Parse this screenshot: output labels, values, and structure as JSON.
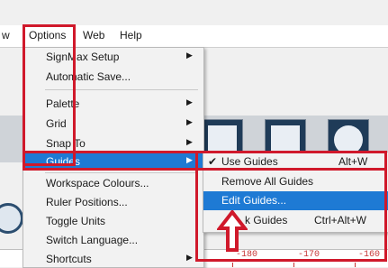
{
  "menubar": {
    "prev_menu_fragment": "w",
    "items": [
      "Options",
      "Web",
      "Help"
    ]
  },
  "options_menu": {
    "items": [
      {
        "label": "SignMax Setup",
        "submenu": true
      },
      {
        "label": "Automatic Save...",
        "submenu": false
      },
      {
        "label": "Palette",
        "submenu": true
      },
      {
        "label": "Grid",
        "submenu": true
      },
      {
        "label": "Snap To",
        "submenu": true
      },
      {
        "label": "Guides",
        "submenu": true,
        "highlighted": true
      },
      {
        "label": "Workspace Colours...",
        "submenu": false
      },
      {
        "label": "Ruler Positions...",
        "submenu": false
      },
      {
        "label": "Toggle Units",
        "submenu": false
      },
      {
        "label": "Switch Language...",
        "submenu": false
      },
      {
        "label": "Shortcuts",
        "submenu": true
      }
    ]
  },
  "guides_submenu": {
    "items": [
      {
        "label": "Use Guides",
        "shortcut": "Alt+W",
        "checked": true
      },
      {
        "label": "Remove All Guides",
        "shortcut": "",
        "checked": false
      },
      {
        "label": "Edit Guides...",
        "shortcut": "",
        "checked": false,
        "highlighted": true
      },
      {
        "label": "Lock Guides",
        "shortcut": "Ctrl+Alt+W",
        "checked": false,
        "visible_label": "k Guides"
      }
    ]
  },
  "ruler": {
    "ticks": [
      "-180",
      "-170",
      "-160"
    ]
  },
  "colors": {
    "highlight": "#1e7ad4",
    "annotation": "#d0192b",
    "ruler_text": "#c73535"
  }
}
